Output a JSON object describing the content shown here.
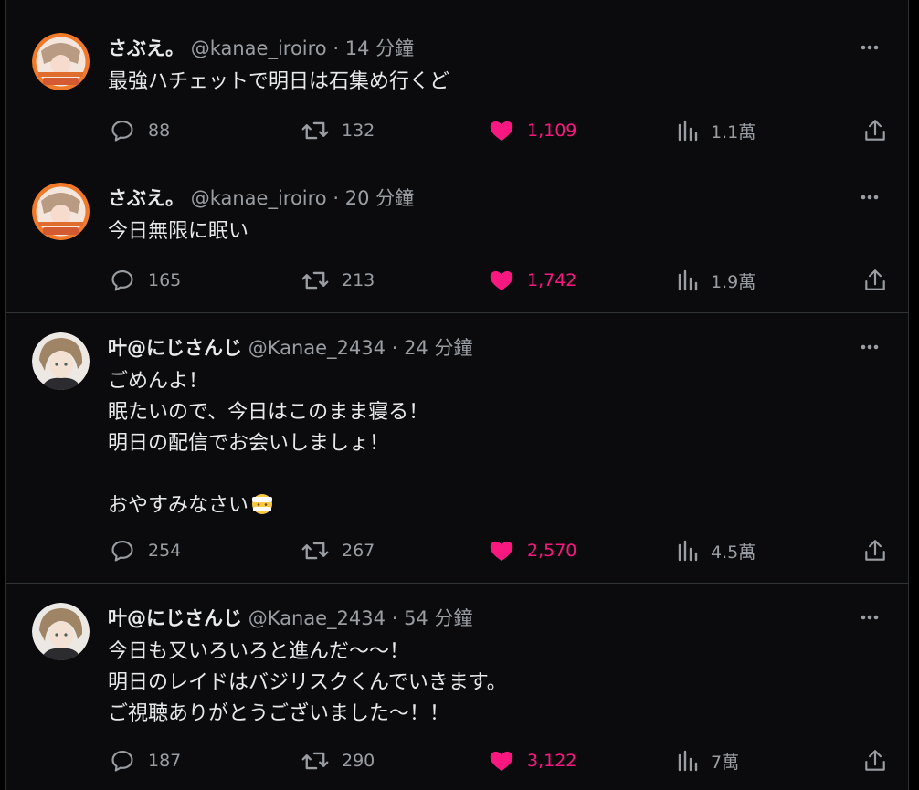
{
  "tweets": [
    {
      "name": "さぶえ。",
      "handle": "@kanae_iroiro",
      "sep": "·",
      "time": "14 分鐘",
      "text": "最強ハチェットで明日は石集め行くど",
      "replies": "88",
      "retweets": "132",
      "likes": "1,109",
      "views": "1.1萬"
    },
    {
      "name": "さぶえ。",
      "handle": "@kanae_iroiro",
      "sep": "·",
      "time": "20 分鐘",
      "text": "今日無限に眠い",
      "replies": "165",
      "retweets": "213",
      "likes": "1,742",
      "views": "1.9萬"
    },
    {
      "name": "叶@にじさんじ",
      "handle": "@Kanae_2434",
      "sep": "·",
      "time": "24 分鐘",
      "text": "ごめんよ！\n眠たいので、今日はこのまま寝る！\n明日の配信でお会いしましょ！\n\nおやすみなさい",
      "emoji": "face-with-bandage-emoji",
      "replies": "254",
      "retweets": "267",
      "likes": "2,570",
      "views": "4.5萬"
    },
    {
      "name": "叶@にじさんじ",
      "handle": "@Kanae_2434",
      "sep": "·",
      "time": "54 分鐘",
      "text": "今日も又いろいろと進んだ〜〜！\n明日のレイドはバジリスクくんでいきます。\nご視聴ありがとうございました〜！！",
      "replies": "187",
      "retweets": "290",
      "likes": "3,122",
      "views": "7萬"
    }
  ],
  "icons": {
    "reply": "reply-icon",
    "retweet": "retweet-icon",
    "like": "heart-icon",
    "views": "views-icon",
    "share": "share-icon",
    "more": "more-icon"
  },
  "colors": {
    "background": "#0b0b0d",
    "text": "#e7e9ea",
    "secondary": "#9a9ea3",
    "like": "#f91880",
    "divider": "#2f3336"
  }
}
